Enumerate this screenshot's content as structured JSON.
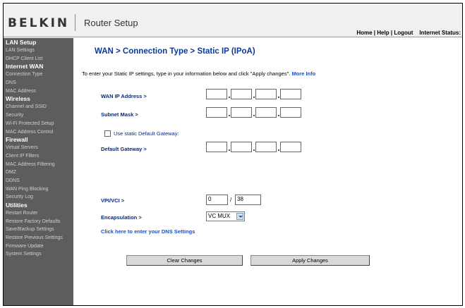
{
  "header": {
    "logo": "BELKIN",
    "title": "Router Setup",
    "nav": [
      "Home",
      "Help",
      "Logout"
    ],
    "nav_sep": "|",
    "status_label": "Internet Status:"
  },
  "sidebar": {
    "sections": [
      {
        "title": "LAN Setup",
        "items": [
          "LAN Settings",
          "DHCP Client List"
        ]
      },
      {
        "title": "Internet WAN",
        "items": [
          "Connection Type",
          "DNS",
          "MAC Address"
        ]
      },
      {
        "title": "Wireless",
        "items": [
          "Channel and SSID",
          "Security",
          "Wi-Fi Protected Setup",
          "MAC Address Control"
        ]
      },
      {
        "title": "Firewall",
        "items": [
          "Virtual Servers",
          "Client IP Filters",
          "MAC Address Filtering",
          "DMZ",
          "DDNS",
          "WAN Ping Blocking",
          "Security Log"
        ]
      },
      {
        "title": "Utilities",
        "items": [
          "Restart Router",
          "Restore Factory Defaults",
          "Save/Backup Settings",
          "Restore Previous Settings",
          "Firmware Update",
          "System Settings"
        ]
      }
    ]
  },
  "main": {
    "title": "WAN > Connection Type > Static IP (IPoA)",
    "intro": "To enter your Static IP settings, type in your information below and click \"Apply changes\".",
    "more_info": "More Info",
    "wan_ip_label": "WAN IP Address >",
    "subnet_label": "Subnet Mask >",
    "static_gw_label": "Use static Default Gateway:",
    "static_gw_checked": false,
    "gateway_label": "Default Gateway >",
    "vpivci_label": "VPI/VCI >",
    "vpi_value": "0",
    "vci_separator": "/",
    "vci_value": "38",
    "encapsulation_label": "Encapsulation >",
    "encapsulation_value": "VC MUX",
    "dns_link": "Click here to enter your DNS Settings",
    "clear_button": "Clear Changes",
    "apply_button": "Apply Changes"
  }
}
